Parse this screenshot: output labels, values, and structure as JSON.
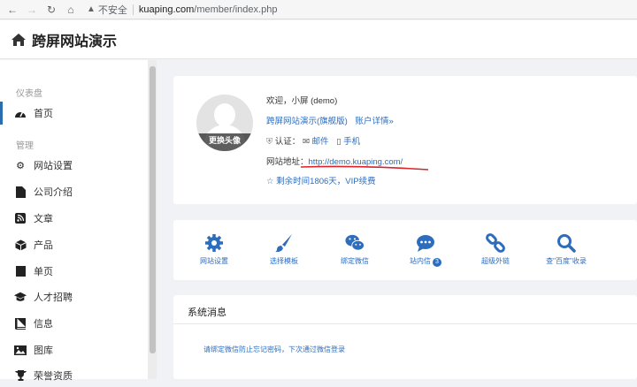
{
  "browser": {
    "security_label": "不安全",
    "url_host": "kuaping.com",
    "url_path": "/member/index.php"
  },
  "header": {
    "title": "跨屏网站演示"
  },
  "sidebar": {
    "section_dashboard": "仪表盘",
    "section_manage": "管理",
    "items": [
      {
        "label": "首页",
        "icon": "dashboard-icon"
      },
      {
        "label": "网站设置",
        "icon": "gear-icon"
      },
      {
        "label": "公司介绍",
        "icon": "file-icon"
      },
      {
        "label": "文章",
        "icon": "rss-icon"
      },
      {
        "label": "产品",
        "icon": "cube-icon"
      },
      {
        "label": "单页",
        "icon": "bookmark-icon"
      },
      {
        "label": "人才招聘",
        "icon": "graduation-cap-icon"
      },
      {
        "label": "信息",
        "icon": "book-icon"
      },
      {
        "label": "图库",
        "icon": "image-icon"
      },
      {
        "label": "荣誉资质",
        "icon": "trophy-icon"
      }
    ]
  },
  "profile": {
    "avatar_button": "更换头像",
    "welcome": "欢迎，小屏 (demo)",
    "plan": "跨屏网站演示(旗舰版)",
    "account_details": "账户详情»",
    "verify_label": "认证：",
    "email_label": "邮件",
    "phone_label": "手机",
    "site_address_label": "网站地址：",
    "site_address_url": "http://demo.kuaping.com/",
    "remaining": "剩余时间1806天，VIP续费"
  },
  "tools": [
    {
      "label": "网站设置",
      "icon": "gear-icon"
    },
    {
      "label": "选择模板",
      "icon": "brush-icon"
    },
    {
      "label": "绑定微信",
      "icon": "wechat-icon"
    },
    {
      "label": "站内信",
      "icon": "chat-icon",
      "badge": "3"
    },
    {
      "label": "超级外链",
      "icon": "link-icon"
    },
    {
      "label": "查\"百度\"收录",
      "icon": "search-icon"
    }
  ],
  "messages": {
    "title": "系统消息",
    "items": [
      "请绑定微信防止忘记密码，下次通过微信登录"
    ]
  },
  "colors": {
    "accent": "#2d6dbd",
    "underline": "#d9232d"
  }
}
